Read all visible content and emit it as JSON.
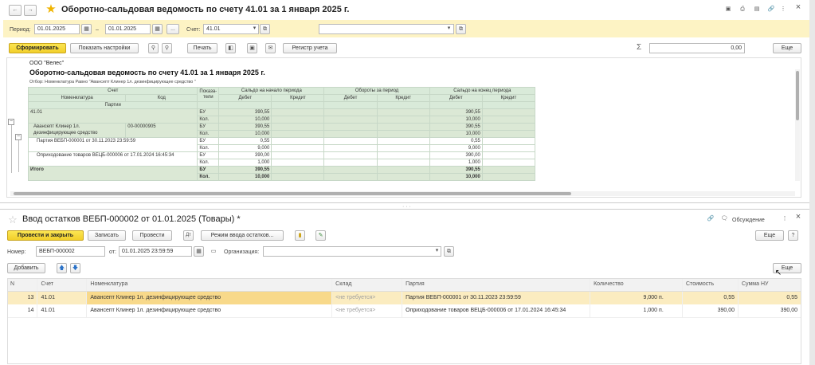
{
  "report": {
    "title": "Оборотно-сальдовая ведомость по счету 41.01 за 1 января 2025 г.",
    "period_label": "Период:",
    "period_from": "01.01.2025",
    "period_dash": "–",
    "period_to": "01.01.2025",
    "period_dots": "...",
    "account_label": "Счет:",
    "account_value": "41.01",
    "btn_generate": "Сформировать",
    "btn_settings": "Показать настройки",
    "btn_print": "Печать",
    "btn_register": "Регистр учета",
    "sum_symbol": "Σ",
    "sum_value": "0,00",
    "btn_more": "Еще",
    "org": "ООО \"Велес\"",
    "heading": "Оборотно-сальдовая ведомость по счету 41.01 за 1 января 2025 г.",
    "filter": "Отбор: Номенклатура Равно \"Авансепт Клинер 1л. дезинфицирующее средство \"",
    "hdr": {
      "account": "Счет",
      "nomenclature": "Номенклатура",
      "code": "Код",
      "batches": "Партии",
      "indicators": "Показа-\nтели",
      "start": "Сальдо на начало периода",
      "turnover": "Обороты за период",
      "end": "Сальдо на конец периода",
      "debit": "Дебет",
      "credit": "Кредит"
    },
    "rows": [
      {
        "name": "41.01",
        "code": "",
        "ind": [
          "БУ",
          "Кол."
        ],
        "start_debit": [
          "390,55",
          "10,000"
        ],
        "end_debit": [
          "390,55",
          "10,000"
        ]
      },
      {
        "name": "Авансепт Клинер 1л. дезинфицирующее средство",
        "code": "00-00000905",
        "ind": [
          "БУ",
          "Кол."
        ],
        "start_debit": [
          "390,55",
          "10,000"
        ],
        "end_debit": [
          "390,55",
          "10,000"
        ]
      },
      {
        "name": "Партия ВЕБП-000001 от 30.11.2023 23:59:59",
        "code": "",
        "ind": [
          "БУ",
          "Кол."
        ],
        "start_debit": [
          "0,55",
          "9,000"
        ],
        "end_debit": [
          "0,55",
          "9,000"
        ]
      },
      {
        "name": "Оприходование товаров ВЕЦБ-000006 от 17.01.2024 16:45:34",
        "code": "",
        "ind": [
          "БУ",
          "Кол."
        ],
        "start_debit": [
          "390,00",
          "1,000"
        ],
        "end_debit": [
          "390,00",
          "1,000"
        ]
      },
      {
        "name": "Итого",
        "code": "",
        "ind": [
          "БУ",
          "Кол."
        ],
        "start_debit": [
          "390,55",
          "10,000"
        ],
        "end_debit": [
          "390,55",
          "10,000"
        ]
      }
    ]
  },
  "doc": {
    "title": "Ввод остатков ВЕБП-000002 от 01.01.2025 (Товары) *",
    "discussion": "Обсуждение",
    "btn_post_close": "Провести и закрыть",
    "btn_save": "Записать",
    "btn_post": "Провести",
    "btn_mode": "Режим ввода остатков...",
    "btn_more": "Еще",
    "number_label": "Номер:",
    "number_value": "ВЕБП-000002",
    "from_label": "от:",
    "date_value": "01.01.2025 23:59:59",
    "org_label": "Организация:",
    "org_value": "",
    "btn_add": "Добавить",
    "btn_more2": "Еще",
    "columns": [
      "N",
      "Счет",
      "Номенклатура",
      "Склад",
      "Партия",
      "Количество",
      "Стоимость",
      "Сумма НУ"
    ],
    "rows": [
      {
        "n": "13",
        "account": "41.01",
        "nomenclature": "Авансепт Клинер 1л. дезинфицирующее средство",
        "warehouse": "<не требуется>",
        "batch": "Партия ВЕБП-000001 от 30.11.2023 23:59:59",
        "qty": "9,000",
        "unit": "п.",
        "cost": "0,55",
        "sum_nu": "0,55"
      },
      {
        "n": "14",
        "account": "41.01",
        "nomenclature": "Авансепт Клинер 1л. дезинфицирующее средство",
        "warehouse": "<не требуется>",
        "batch": "Оприходование товаров ВЕЦБ-000006 от 17.01.2024 16:45:34",
        "qty": "1,000",
        "unit": "п.",
        "cost": "390,00",
        "sum_nu": "390,00"
      }
    ]
  },
  "icons": {
    "back": "←",
    "forward": "→",
    "star": "★",
    "close": "×",
    "calendar": "▦",
    "dropdown": "▾",
    "open": "⧉",
    "search": "⚲",
    "up": "🡅",
    "down": "🡇",
    "chain": "🔗",
    "menu": "⋮",
    "save": "▣",
    "mail": "✉"
  },
  "colors": {
    "accent": "#f2cf2a",
    "selection": "#fbecc0",
    "header_green": "#d9ead9",
    "panel": "#fdf3c4"
  }
}
